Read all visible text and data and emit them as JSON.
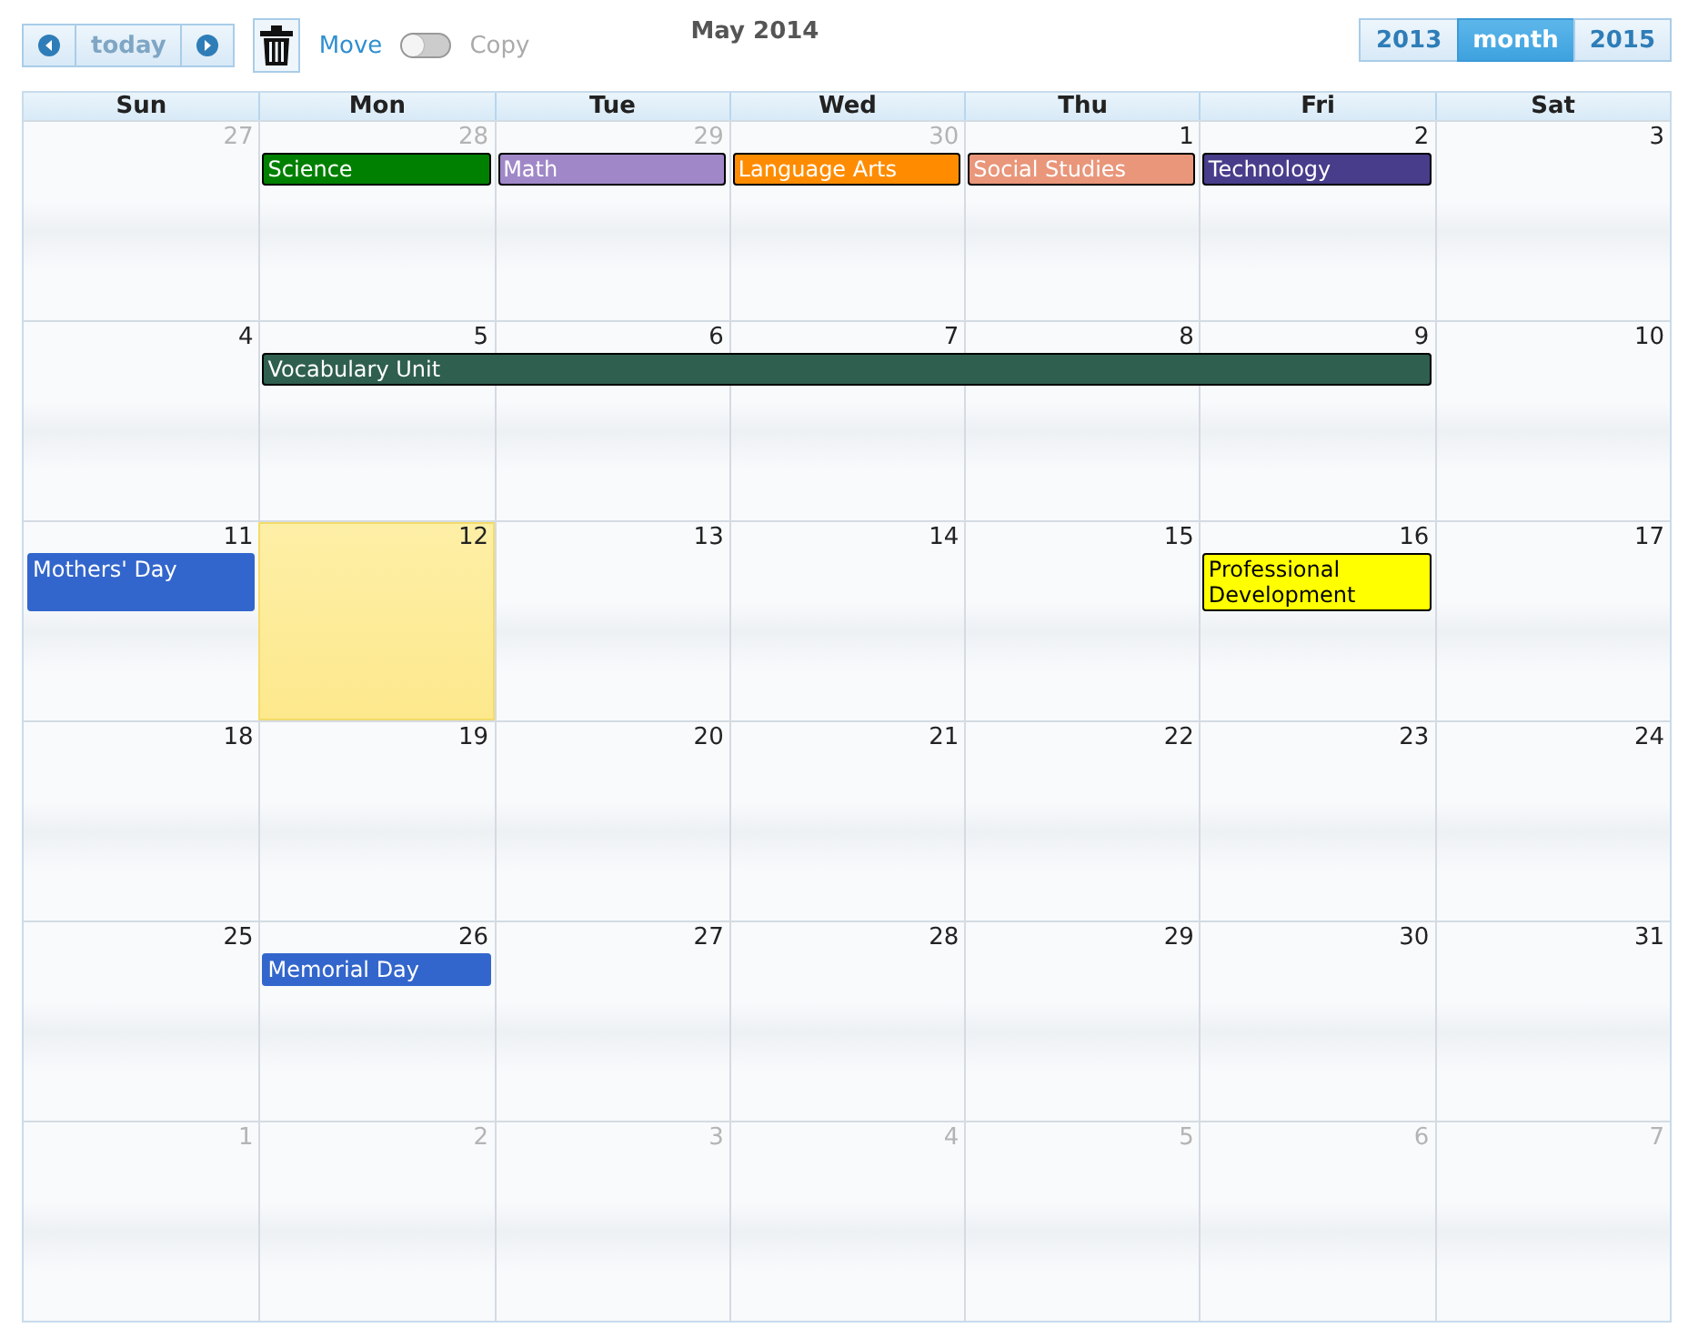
{
  "toolbar": {
    "today_label": "today",
    "today_disabled": true,
    "move_label": "Move",
    "copy_label": "Copy",
    "copy_on": false
  },
  "title": "May 2014",
  "views": [
    {
      "label": "2013",
      "selected": false
    },
    {
      "label": "month",
      "selected": true
    },
    {
      "label": "2015",
      "selected": false
    }
  ],
  "weekdays": [
    "Sun",
    "Mon",
    "Tue",
    "Wed",
    "Thu",
    "Fri",
    "Sat"
  ],
  "weeks": [
    {
      "days": [
        {
          "number": "27",
          "other_month": true,
          "today": false
        },
        {
          "number": "28",
          "other_month": true,
          "today": false,
          "events": [
            {
              "title": "Science",
              "color": "#008000",
              "kind": "class"
            }
          ]
        },
        {
          "number": "29",
          "other_month": true,
          "today": false,
          "events": [
            {
              "title": "Math",
              "color": "#a088c8",
              "kind": "class"
            }
          ]
        },
        {
          "number": "30",
          "other_month": true,
          "today": false,
          "events": [
            {
              "title": "Language Arts",
              "color": "#ff8c00",
              "kind": "class"
            }
          ]
        },
        {
          "number": "1",
          "other_month": false,
          "today": false,
          "events": [
            {
              "title": "Social Studies",
              "color": "#e9967a",
              "kind": "class"
            }
          ]
        },
        {
          "number": "2",
          "other_month": false,
          "today": false,
          "events": [
            {
              "title": "Technology",
              "color": "#483d8b",
              "kind": "class"
            }
          ]
        },
        {
          "number": "3",
          "other_month": false,
          "today": false
        }
      ]
    },
    {
      "days": [
        {
          "number": "4",
          "other_month": false,
          "today": false
        },
        {
          "number": "5",
          "other_month": false,
          "today": false,
          "events": [
            {
              "title": "Vocabulary Unit",
              "color": "#2f5f4f",
              "kind": "class"
            }
          ]
        },
        {
          "number": "6",
          "other_month": false,
          "today": false,
          "continued": true
        },
        {
          "number": "7",
          "other_month": false,
          "today": false,
          "continued": true
        },
        {
          "number": "8",
          "other_month": false,
          "today": false,
          "continued": true
        },
        {
          "number": "9",
          "other_month": false,
          "today": false,
          "continued": true
        },
        {
          "number": "10",
          "other_month": false,
          "today": false
        }
      ]
    },
    {
      "days": [
        {
          "number": "11",
          "other_month": false,
          "today": false,
          "events": [
            {
              "title": "Mothers' Day",
              "color": "#3366cc",
              "kind": "holiday"
            }
          ]
        },
        {
          "number": "12",
          "other_month": false,
          "today": true
        },
        {
          "number": "13",
          "other_month": false,
          "today": false
        },
        {
          "number": "14",
          "other_month": false,
          "today": false
        },
        {
          "number": "15",
          "other_month": false,
          "today": false
        },
        {
          "number": "16",
          "other_month": false,
          "today": false,
          "events": [
            {
              "title": "Professional Development",
              "color": "#ffff00",
              "kind": "class"
            }
          ]
        },
        {
          "number": "17",
          "other_month": false,
          "today": false
        }
      ]
    },
    {
      "days": [
        {
          "number": "18",
          "other_month": false,
          "today": false
        },
        {
          "number": "19",
          "other_month": false,
          "today": false
        },
        {
          "number": "20",
          "other_month": false,
          "today": false
        },
        {
          "number": "21",
          "other_month": false,
          "today": false
        },
        {
          "number": "22",
          "other_month": false,
          "today": false
        },
        {
          "number": "23",
          "other_month": false,
          "today": false
        },
        {
          "number": "24",
          "other_month": false,
          "today": false
        }
      ]
    },
    {
      "days": [
        {
          "number": "25",
          "other_month": false,
          "today": false
        },
        {
          "number": "26",
          "other_month": false,
          "today": false,
          "events": [
            {
              "title": "Memorial Day",
              "color": "#3366cc",
              "kind": "holiday"
            }
          ]
        },
        {
          "number": "27",
          "other_month": false,
          "today": false
        },
        {
          "number": "28",
          "other_month": false,
          "today": false
        },
        {
          "number": "29",
          "other_month": false,
          "today": false
        },
        {
          "number": "30",
          "other_month": false,
          "today": false
        },
        {
          "number": "31",
          "other_month": false,
          "today": false
        }
      ]
    },
    {
      "days": [
        {
          "number": "1",
          "other_month": true,
          "today": false
        },
        {
          "number": "2",
          "other_month": true,
          "today": false
        },
        {
          "number": "3",
          "other_month": true,
          "today": false
        },
        {
          "number": "4",
          "other_month": true,
          "today": false
        },
        {
          "number": "5",
          "other_month": true,
          "today": false
        },
        {
          "number": "6",
          "other_month": true,
          "today": false
        },
        {
          "number": "7",
          "other_month": true,
          "today": false
        }
      ]
    }
  ]
}
